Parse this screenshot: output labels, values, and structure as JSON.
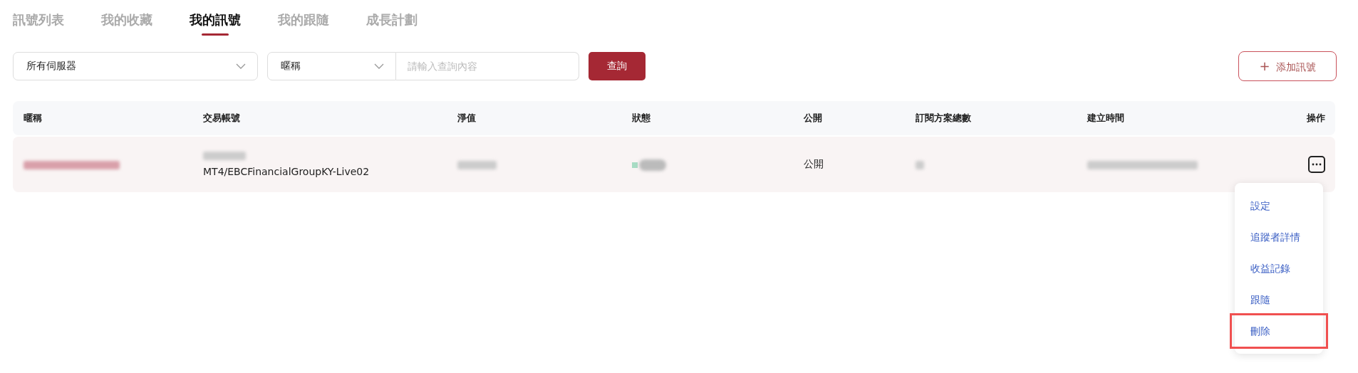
{
  "tabs": [
    {
      "label": "訊號列表",
      "selected": false
    },
    {
      "label": "我的收藏",
      "selected": false
    },
    {
      "label": "我的訊號",
      "selected": true
    },
    {
      "label": "我的跟隨",
      "selected": false
    },
    {
      "label": "成長計劃",
      "selected": false
    }
  ],
  "filters": {
    "server": {
      "value": "所有伺服器"
    },
    "field": {
      "value": "暱稱"
    },
    "search": {
      "placeholder": "請輸入查詢內容"
    },
    "query_button": "查詢",
    "add_button": {
      "icon": "+",
      "label": "添加訊號"
    }
  },
  "table": {
    "columns": [
      "暱稱",
      "交易帳號",
      "淨值",
      "狀態",
      "公開",
      "訂閱方案總數",
      "建立時間",
      "操作"
    ],
    "rows": [
      {
        "cells": [
          {
            "kind": "redacted"
          },
          {
            "kind": "account",
            "text": "MT4/EBCFinancialGroupKY-Live02"
          },
          {
            "kind": "redacted"
          },
          {
            "kind": "status"
          },
          {
            "kind": "text",
            "text": "公開"
          },
          {
            "kind": "redacted"
          },
          {
            "kind": "redacted"
          },
          {
            "kind": "actions"
          }
        ]
      }
    ]
  },
  "menu": {
    "items": [
      {
        "label": "設定",
        "highlighted": false
      },
      {
        "label": "追蹤者詳情",
        "highlighted": false
      },
      {
        "label": "收益記錄",
        "highlighted": false
      },
      {
        "label": "跟隨",
        "highlighted": false
      },
      {
        "label": "刪除",
        "highlighted": true
      }
    ]
  }
}
